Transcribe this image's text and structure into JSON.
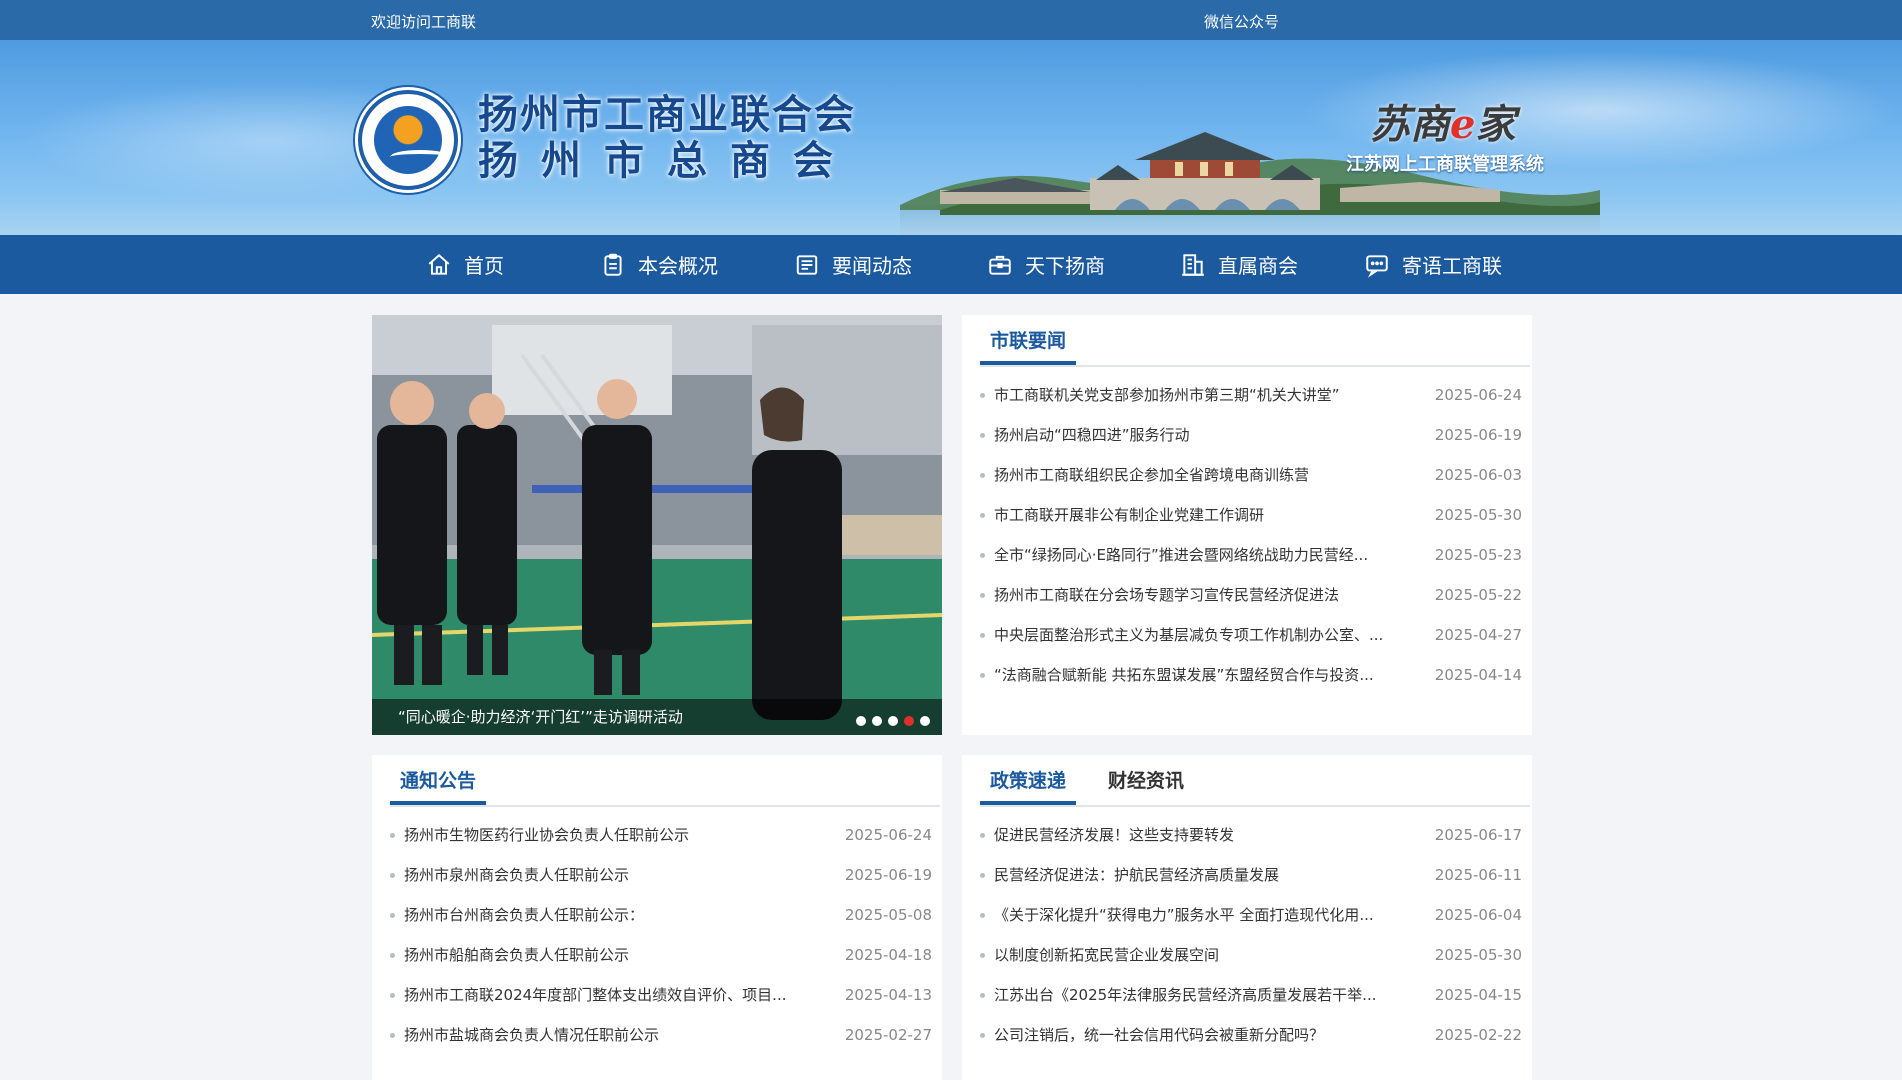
{
  "topbar": {
    "welcome": "欢迎访问工商联",
    "wechat": "微信公众号"
  },
  "header": {
    "title_line1": "扬州市工商业联合会",
    "title_line2": "扬州市总商会",
    "brand_part1": "苏商",
    "brand_e": "e",
    "brand_part2": "家",
    "brand_sub": "江苏网上工商联管理系统"
  },
  "nav": {
    "items": [
      {
        "label": "首页",
        "icon": "home-icon"
      },
      {
        "label": "本会概况",
        "icon": "clipboard-icon"
      },
      {
        "label": "要闻动态",
        "icon": "news-icon"
      },
      {
        "label": "天下扬商",
        "icon": "briefcase-icon"
      },
      {
        "label": "直属商会",
        "icon": "building-icon"
      },
      {
        "label": "寄语工商联",
        "icon": "message-icon"
      }
    ]
  },
  "slider": {
    "caption": "“同心暖企·助力经济‘开门红’”走访调研活动",
    "dots": 5,
    "active_dot": 4
  },
  "news": {
    "tab": "市联要闻",
    "items": [
      {
        "title": "市工商联机关党支部参加扬州市第三期“机关大讲堂”",
        "date": "2025-06-24"
      },
      {
        "title": "扬州启动“四稳四进”服务行动",
        "date": "2025-06-19"
      },
      {
        "title": "扬州市工商联组织民企参加全省跨境电商训练营",
        "date": "2025-06-03"
      },
      {
        "title": "市工商联开展非公有制企业党建工作调研",
        "date": "2025-05-30"
      },
      {
        "title": "全市“绿扬同心·E路同行”推进会暨网络统战助力民营经...",
        "date": "2025-05-23"
      },
      {
        "title": "扬州市工商联在分会场专题学习宣传民营经济促进法",
        "date": "2025-05-22"
      },
      {
        "title": "中央层面整治形式主义为基层减负专项工作机制办公室、...",
        "date": "2025-04-27"
      },
      {
        "title": "“法商融合赋新能 共拓东盟谋发展”东盟经贸合作与投资...",
        "date": "2025-04-14"
      }
    ]
  },
  "notices": {
    "tab": "通知公告",
    "items": [
      {
        "title": "扬州市生物医药行业协会负责人任职前公示",
        "date": "2025-06-24"
      },
      {
        "title": "扬州市泉州商会负责人任职前公示",
        "date": "2025-06-19"
      },
      {
        "title": "扬州市台州商会负责人任职前公示：",
        "date": "2025-05-08"
      },
      {
        "title": "扬州市船舶商会负责人任职前公示",
        "date": "2025-04-18"
      },
      {
        "title": "扬州市工商联2024年度部门整体支出绩效自评价、项目...",
        "date": "2025-04-13"
      },
      {
        "title": "扬州市盐城商会负责人情况任职前公示",
        "date": "2025-02-27"
      }
    ]
  },
  "policy": {
    "tab_active": "政策速递",
    "tab_other": "财经资讯",
    "items": [
      {
        "title": "促进民营经济发展！这些支持要转发",
        "date": "2025-06-17"
      },
      {
        "title": "民营经济促进法：护航民营经济高质量发展",
        "date": "2025-06-11"
      },
      {
        "title": "《关于深化提升“获得电力”服务水平 全面打造现代化用...",
        "date": "2025-06-04"
      },
      {
        "title": "以制度创新拓宽民营企业发展空间",
        "date": "2025-05-30"
      },
      {
        "title": "江苏出台《2025年法律服务民营经济高质量发展若干举...",
        "date": "2025-04-15"
      },
      {
        "title": "公司注销后，统一社会信用代码会被重新分配吗？",
        "date": "2025-02-22"
      }
    ]
  },
  "colors": {
    "nav": "#1c5aa0",
    "topbar": "#2a6aa8",
    "accent": "#1c5aa0",
    "dot_active": "#e0302a"
  }
}
